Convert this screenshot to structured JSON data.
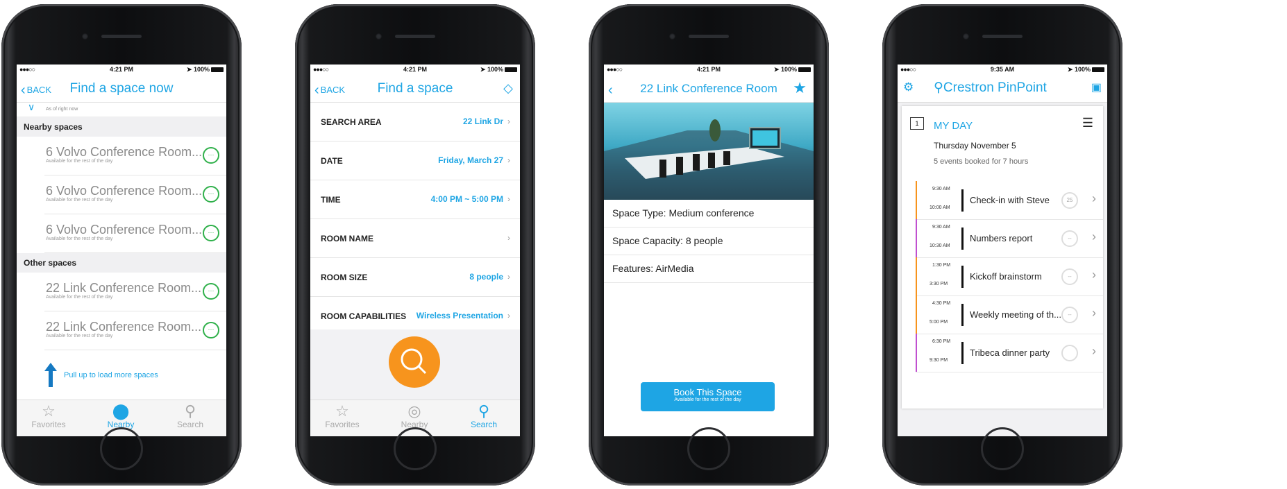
{
  "status": {
    "carrier": "●●●○○ ",
    "battery": "100%"
  },
  "phone1": {
    "time": "4:21 PM",
    "back": "BACK",
    "title": "Find a space now",
    "as_of": "As of right now",
    "nearby_header": "Nearby spaces",
    "nearby": [
      {
        "name": "6 Volvo Conference Room...",
        "sub": "Available for the rest of the day"
      },
      {
        "name": "6 Volvo Conference Room...",
        "sub": "Available for the rest of the day"
      },
      {
        "name": "6 Volvo Conference Room...",
        "sub": "Available for the rest of the day"
      }
    ],
    "other_header": "Other spaces",
    "other": [
      {
        "name": "22 Link Conference Room...",
        "sub": "Available for the rest of the day"
      },
      {
        "name": "22 Link Conference Room...",
        "sub": "Available for the rest of the day"
      }
    ],
    "pullup": "Pull up to load more spaces",
    "tabs": [
      "Favorites",
      "Nearby",
      "Search"
    ]
  },
  "phone2": {
    "time": "4:21 PM",
    "back": "BACK",
    "title": "Find a space",
    "rows": [
      {
        "label": "SEARCH AREA",
        "value": "22 Link Dr"
      },
      {
        "label": "DATE",
        "value": "Friday, March 27"
      },
      {
        "label": "TIME",
        "value": "4:00 PM ~ 5:00 PM"
      },
      {
        "label": "ROOM NAME",
        "value": ""
      },
      {
        "label": "ROOM SIZE",
        "value": "8 people"
      },
      {
        "label": "ROOM CAPABILITIES",
        "value": "Wireless Presentation"
      }
    ],
    "tabs": [
      "Favorites",
      "Nearby",
      "Search"
    ]
  },
  "phone3": {
    "time": "4:21 PM",
    "title": "22 Link Conference Room",
    "details": [
      "Space Type: Medium conference",
      "Space Capacity: 8 people",
      "Features: AirMedia"
    ],
    "book": "Book This Space",
    "book_sub": "Available for the rest of the day"
  },
  "phone4": {
    "time": "9:35 AM",
    "brand": "Crestron PinPoint",
    "my_day": "MY DAY",
    "calendar_day": "1",
    "date": "Thursday November 5",
    "summary": "5 events booked for 7 hours",
    "events": [
      {
        "start": "9:30 AM",
        "end": "10:00 AM",
        "name": "Check-in with Steve",
        "badge": "25",
        "color": "#f7941d"
      },
      {
        "start": "9:30 AM",
        "end": "10:30 AM",
        "name": "Numbers report",
        "badge": "--",
        "color": "#c050d0"
      },
      {
        "start": "1:30 PM",
        "end": "3:30 PM",
        "name": "Kickoff brainstorm",
        "badge": "--",
        "color": "#f7941d"
      },
      {
        "start": "4:30 PM",
        "end": "5:00 PM",
        "name": "Weekly meeting of th...",
        "badge": "--",
        "color": "#f7941d"
      },
      {
        "start": "6:30 PM",
        "end": "9:30 PM",
        "name": "Tribeca dinner party",
        "badge": "",
        "color": "#c050d0"
      }
    ]
  },
  "colors": {
    "accent": "#1ea5e4",
    "available": "#2fb04a",
    "search_button": "#f7941d"
  }
}
